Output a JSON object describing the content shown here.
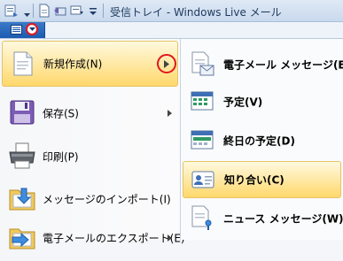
{
  "window": {
    "title": "受信トレイ - Windows Live メール"
  },
  "app_menu": {
    "left_items": [
      {
        "label": "新規作成(N)",
        "icon": "new-document-icon",
        "has_submenu": true,
        "highlighted": true
      },
      {
        "label": "保存(S)",
        "icon": "floppy-disk-icon",
        "has_submenu": true,
        "highlighted": false
      },
      {
        "label": "印刷(P)",
        "icon": "printer-icon",
        "has_submenu": false,
        "highlighted": false
      },
      {
        "label": "メッセージのインポート(I)",
        "icon": "import-folder-icon",
        "has_submenu": false,
        "highlighted": false
      },
      {
        "label": "電子メールのエクスポート(E)",
        "icon": "export-folder-icon",
        "has_submenu": true,
        "highlighted": false
      }
    ],
    "right_items": [
      {
        "label": "電子メール メッセージ(E)",
        "icon": "email-message-icon",
        "highlighted": false
      },
      {
        "label": "予定(V)",
        "icon": "calendar-icon",
        "highlighted": false
      },
      {
        "label": "終日の予定(D)",
        "icon": "all-day-calendar-icon",
        "highlighted": false
      },
      {
        "label": "知り合い(C)",
        "icon": "contact-card-icon",
        "highlighted": true
      },
      {
        "label": "ニュース メッセージ(W)",
        "icon": "news-message-icon",
        "highlighted": false
      }
    ]
  },
  "colors": {
    "highlight": "#ffe7a0",
    "annotation_circle": "#e0181e",
    "app_button": "#1c5bb0"
  }
}
